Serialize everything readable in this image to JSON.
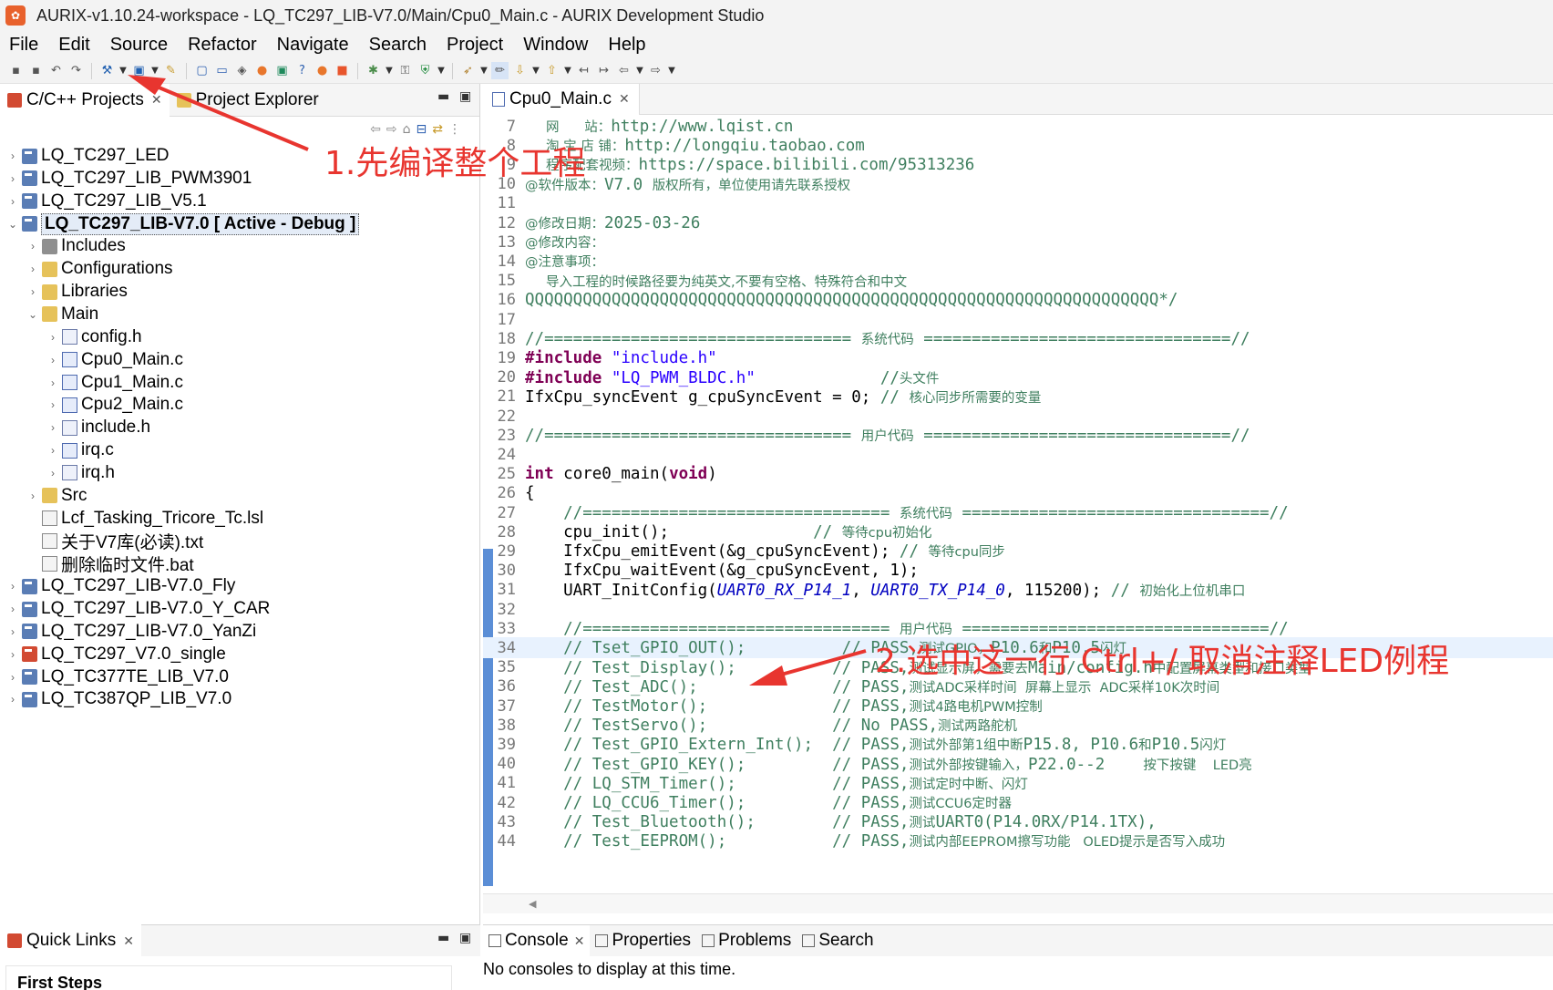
{
  "window": {
    "title": "AURIX-v1.10.24-workspace - LQ_TC297_LIB-V7.0/Main/Cpu0_Main.c - AURIX Development Studio"
  },
  "menu": [
    "File",
    "Edit",
    "Source",
    "Refactor",
    "Navigate",
    "Search",
    "Project",
    "Window",
    "Help"
  ],
  "left_tabs": {
    "projects": "C/C++ Projects",
    "explorer": "Project Explorer"
  },
  "tree": [
    {
      "label": "LQ_TC297_LED",
      "level": 0,
      "icon": "project-icon"
    },
    {
      "label": "LQ_TC297_LIB_PWM3901",
      "level": 0,
      "icon": "project-icon"
    },
    {
      "label": "LQ_TC297_LIB_V5.1",
      "level": 0,
      "icon": "project-icon"
    },
    {
      "label": "LQ_TC297_LIB-V7.0 [ Active - Debug ]",
      "level": 0,
      "icon": "project-icon",
      "expanded": true,
      "selected": true
    },
    {
      "label": "Includes",
      "level": 1,
      "icon": "includes-icon"
    },
    {
      "label": "Configurations",
      "level": 1,
      "icon": "folder-icon"
    },
    {
      "label": "Libraries",
      "level": 1,
      "icon": "folder-icon"
    },
    {
      "label": "Main",
      "level": 1,
      "icon": "folder-icon",
      "expanded": true
    },
    {
      "label": "config.h",
      "level": 2,
      "icon": "header-file-icon"
    },
    {
      "label": "Cpu0_Main.c",
      "level": 2,
      "icon": "c-file-icon"
    },
    {
      "label": "Cpu1_Main.c",
      "level": 2,
      "icon": "c-file-icon"
    },
    {
      "label": "Cpu2_Main.c",
      "level": 2,
      "icon": "c-file-icon"
    },
    {
      "label": "include.h",
      "level": 2,
      "icon": "header-file-icon"
    },
    {
      "label": "irq.c",
      "level": 2,
      "icon": "c-file-icon"
    },
    {
      "label": "irq.h",
      "level": 2,
      "icon": "header-file-icon"
    },
    {
      "label": "Src",
      "level": 1,
      "icon": "folder-icon"
    },
    {
      "label": "Lcf_Tasking_Tricore_Tc.lsl",
      "level": 1,
      "icon": "text-file-icon",
      "leaf": true
    },
    {
      "label": "关于V7库(必读).txt",
      "level": 1,
      "icon": "text-file-icon",
      "leaf": true
    },
    {
      "label": "删除临时文件.bat",
      "level": 1,
      "icon": "text-file-icon",
      "leaf": true
    },
    {
      "label": "LQ_TC297_LIB-V7.0_Fly",
      "level": 0,
      "icon": "project-icon"
    },
    {
      "label": "LQ_TC297_LIB-V7.0_Y_CAR",
      "level": 0,
      "icon": "project-icon"
    },
    {
      "label": "LQ_TC297_LIB-V7.0_YanZi",
      "level": 0,
      "icon": "project-icon"
    },
    {
      "label": "LQ_TC297_V7.0_single",
      "level": 0,
      "icon": "project-icon"
    },
    {
      "label": "LQ_TC377TE_LIB_V7.0",
      "level": 0,
      "icon": "project-icon"
    },
    {
      "label": "LQ_TC387QP_LIB_V7.0",
      "level": 0,
      "icon": "project-icon"
    }
  ],
  "quick_links": {
    "tab": "Quick Links",
    "first_steps": "First Steps"
  },
  "editor": {
    "tab": "Cpu0_Main.c",
    "lines": [
      {
        "n": "7",
        "segs": [
          [
            "cz",
            "     网      站："
          ],
          [
            "c",
            "http://www.lqist.cn"
          ]
        ]
      },
      {
        "n": "8",
        "segs": [
          [
            "cz",
            "     淘 宝 店 铺："
          ],
          [
            "c",
            "http://longqiu.taobao.com"
          ]
        ]
      },
      {
        "n": "9",
        "segs": [
          [
            "cz",
            "     程序配套视频："
          ],
          [
            "c",
            "https://space.bilibili.com/95313236"
          ]
        ]
      },
      {
        "n": "10",
        "segs": [
          [
            "cz",
            "@软件版本："
          ],
          [
            "c",
            "V7.0 "
          ],
          [
            "cz",
            "版权所有，单位使用请先联系授权"
          ]
        ]
      },
      {
        "n": "11",
        "segs": []
      },
      {
        "n": "12",
        "segs": [
          [
            "cz",
            "@修改日期："
          ],
          [
            "c",
            "2025-03-26"
          ]
        ]
      },
      {
        "n": "13",
        "segs": [
          [
            "cz",
            "@修改内容："
          ]
        ]
      },
      {
        "n": "14",
        "segs": [
          [
            "cz",
            "@注意事项："
          ]
        ]
      },
      {
        "n": "15",
        "segs": [
          [
            "cz",
            "     导入工程的时候路径要为纯英文,不要有空格、特殊符合和中文"
          ]
        ]
      },
      {
        "n": "16",
        "segs": [
          [
            "c",
            "QQQQQQQQQQQQQQQQQQQQQQQQQQQQQQQQQQQQQQQQQQQQQQQQQQQQQQQQQQQQQQQQQQ*/"
          ]
        ]
      },
      {
        "n": "17",
        "segs": []
      },
      {
        "n": "18",
        "segs": [
          [
            "c",
            "//================================ "
          ],
          [
            "cz",
            "系统代码"
          ],
          [
            "c",
            " ================================//"
          ]
        ]
      },
      {
        "n": "19",
        "segs": [
          [
            "k",
            "#include "
          ],
          [
            "s",
            "\"include.h\""
          ]
        ]
      },
      {
        "n": "20",
        "segs": [
          [
            "k",
            "#include "
          ],
          [
            "s",
            "\"LQ_PWM_BLDC.h\""
          ],
          [
            "c",
            "             //"
          ],
          [
            "cz",
            "头文件"
          ]
        ]
      },
      {
        "n": "21",
        "segs": [
          [
            "plain",
            "IfxCpu_syncEvent g_cpuSyncEvent = 0; "
          ],
          [
            "c",
            "// "
          ],
          [
            "cz",
            "核心同步所需要的变量"
          ]
        ]
      },
      {
        "n": "22",
        "segs": []
      },
      {
        "n": "23",
        "segs": [
          [
            "c",
            "//================================ "
          ],
          [
            "cz",
            "用户代码"
          ],
          [
            "c",
            " ================================//"
          ]
        ]
      },
      {
        "n": "24",
        "segs": []
      },
      {
        "n": "25",
        "segs": [
          [
            "k",
            "int "
          ],
          [
            "plain",
            "core0_main("
          ],
          [
            "k",
            "void"
          ],
          [
            "plain",
            ")"
          ]
        ]
      },
      {
        "n": "26",
        "segs": [
          [
            "plain",
            "{"
          ]
        ]
      },
      {
        "n": "27",
        "segs": [
          [
            "c",
            "    //================================ "
          ],
          [
            "cz",
            "系统代码"
          ],
          [
            "c",
            " ================================//"
          ]
        ]
      },
      {
        "n": "28",
        "segs": [
          [
            "plain",
            "    cpu_init();               "
          ],
          [
            "c",
            "// "
          ],
          [
            "cz",
            "等待cpu初始化"
          ]
        ]
      },
      {
        "n": "29",
        "segs": [
          [
            "plain",
            "    IfxCpu_emitEvent(&g_cpuSyncEvent); "
          ],
          [
            "c",
            "// "
          ],
          [
            "cz",
            "等待cpu同步"
          ]
        ]
      },
      {
        "n": "30",
        "segs": [
          [
            "plain",
            "    IfxCpu_waitEvent(&g_cpuSyncEvent, 1);"
          ]
        ]
      },
      {
        "n": "31",
        "segs": [
          [
            "plain",
            "    UART_InitConfig("
          ],
          [
            "it",
            "UART0_RX_P14_1"
          ],
          [
            "plain",
            ", "
          ],
          [
            "it",
            "UART0_TX_P14_0"
          ],
          [
            "plain",
            ", 115200); "
          ],
          [
            "c",
            "// "
          ],
          [
            "cz",
            "初始化上位机串口"
          ]
        ]
      },
      {
        "n": "32",
        "segs": []
      },
      {
        "n": "33",
        "segs": [
          [
            "c",
            "    //================================ "
          ],
          [
            "cz",
            "用户代码"
          ],
          [
            "c",
            " ================================//"
          ]
        ]
      },
      {
        "n": "34",
        "hl": true,
        "segs": [
          [
            "c",
            "    // Tset_GPIO_OUT();          // PASS,"
          ],
          [
            "cz",
            "测试GPIO，"
          ],
          [
            "c",
            "P10.6"
          ],
          [
            "cz",
            "和"
          ],
          [
            "c",
            "P10.5"
          ],
          [
            "cz",
            "闪灯"
          ]
        ]
      },
      {
        "n": "35",
        "segs": [
          [
            "c",
            "    // Test_Display();          // PASS,"
          ],
          [
            "cz",
            "测试显示屏，需要去"
          ],
          [
            "c",
            "Main/config.h"
          ],
          [
            "cz",
            "中配置屏幕类型和接口类型"
          ]
        ]
      },
      {
        "n": "36",
        "segs": [
          [
            "c",
            "    // Test_ADC();              // PASS,"
          ],
          [
            "cz",
            "测试ADC采样时间  屏幕上显示  ADC采样10K次时间"
          ]
        ]
      },
      {
        "n": "37",
        "segs": [
          [
            "c",
            "    // TestMotor();             // PASS,"
          ],
          [
            "cz",
            "测试4路电机PWM控制"
          ]
        ]
      },
      {
        "n": "38",
        "segs": [
          [
            "c",
            "    // TestServo();             // No PASS,"
          ],
          [
            "cz",
            "测试两路舵机"
          ]
        ]
      },
      {
        "n": "39",
        "segs": [
          [
            "c",
            "    // Test_GPIO_Extern_Int();  // PASS,"
          ],
          [
            "cz",
            "测试外部第1组中断"
          ],
          [
            "c",
            "P15.8, P10.6"
          ],
          [
            "cz",
            "和"
          ],
          [
            "c",
            "P10.5"
          ],
          [
            "cz",
            "闪灯"
          ]
        ]
      },
      {
        "n": "40",
        "segs": [
          [
            "c",
            "    // Test_GPIO_KEY();         // PASS,"
          ],
          [
            "cz",
            "测试外部按键输入，"
          ],
          [
            "c",
            "P22.0--2    "
          ],
          [
            "cz",
            "按下按键    LED亮"
          ]
        ]
      },
      {
        "n": "41",
        "segs": [
          [
            "c",
            "    // LQ_STM_Timer();          // PASS,"
          ],
          [
            "cz",
            "测试定时中断、闪灯"
          ]
        ]
      },
      {
        "n": "42",
        "segs": [
          [
            "c",
            "    // LQ_CCU6_Timer();         // PASS,"
          ],
          [
            "cz",
            "测试CCU6定时器"
          ]
        ]
      },
      {
        "n": "43",
        "segs": [
          [
            "c",
            "    // Test_Bluetooth();        // PASS,"
          ],
          [
            "cz",
            "测试"
          ],
          [
            "c",
            "UART0(P14.0RX/P14.1TX),"
          ]
        ]
      },
      {
        "n": "44",
        "segs": [
          [
            "c",
            "    // Test_EEPROM();           // PASS,"
          ],
          [
            "cz",
            "测试内部EEPROM擦写功能   OLED提示是否写入成功"
          ]
        ]
      }
    ]
  },
  "console": {
    "tabs": [
      "Console",
      "Properties",
      "Problems",
      "Search"
    ],
    "message": "No consoles to display at this time."
  },
  "annotations": {
    "step1": "1.先编译整个工程",
    "step2": "2.选中这一行 Ctrl+/ 取消注释LED例程"
  },
  "colors": {
    "annotation": "#e8352f",
    "keyword": "#7f0055",
    "string": "#2a00ff",
    "comment": "#3f7f5f",
    "highlight": "#e8f2fe"
  }
}
